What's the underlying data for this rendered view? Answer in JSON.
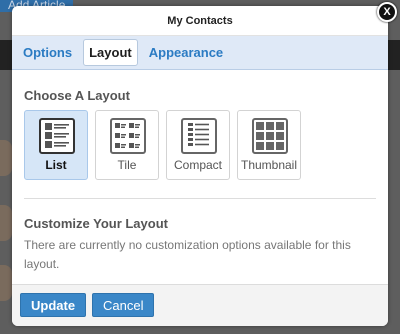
{
  "background": {
    "header_button_label": "Add Article"
  },
  "modal": {
    "title": "My Contacts",
    "close_label": "X",
    "tabs": [
      {
        "label": "Options",
        "active": false
      },
      {
        "label": "Layout",
        "active": true
      },
      {
        "label": "Appearance",
        "active": false
      }
    ],
    "choose_layout_heading": "Choose A Layout",
    "layouts": [
      {
        "label": "List",
        "icon": "list-layout-icon",
        "selected": true
      },
      {
        "label": "Tile",
        "icon": "tile-layout-icon",
        "selected": false
      },
      {
        "label": "Compact",
        "icon": "compact-layout-icon",
        "selected": false
      },
      {
        "label": "Thumbnail",
        "icon": "thumbnail-layout-icon",
        "selected": false
      }
    ],
    "customize_heading": "Customize Your Layout",
    "customize_message": "There are currently no customization options available for this layout.",
    "footer": {
      "update_label": "Update",
      "cancel_label": "Cancel"
    }
  },
  "colors": {
    "accent": "#2b7bc3",
    "button": "#3a87c8",
    "tabbar": "#dfe9f7",
    "selected_card": "#d6e6f7"
  }
}
